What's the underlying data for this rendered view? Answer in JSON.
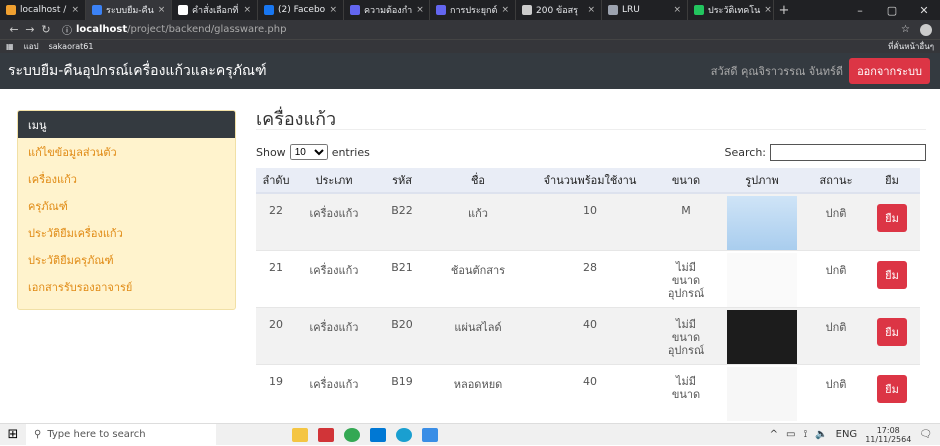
{
  "browser": {
    "tabs": [
      {
        "label": "localhost /",
        "color": "#f0a030"
      },
      {
        "label": "ระบบยืม-คืน",
        "color": "#3b82f6",
        "active": true
      },
      {
        "label": "คำสั่งเลือกที่",
        "color": "#ffffff"
      },
      {
        "label": "(2) Facebo",
        "color": "#1877f2"
      },
      {
        "label": "ความต้องกำ",
        "color": "#6366f1"
      },
      {
        "label": "การประยุกต์",
        "color": "#6366f1"
      },
      {
        "label": "200 ข้อสรุ",
        "color": "#cccccc"
      },
      {
        "label": "LRU",
        "color": "#9ca3af"
      },
      {
        "label": "ประวัติเทคโน",
        "color": "#22c55e"
      }
    ],
    "url_host": "localhost",
    "url_path": "/project/backend/glassware.php",
    "bookmarks": {
      "apps": "แอป",
      "profile": "sakaorat61",
      "other": "ที่คั่นหน้าอื่นๆ"
    }
  },
  "navbar": {
    "brand": "ระบบยืม-คืนอุปกรณ์เครื่องแก้วและครุภัณฑ์",
    "user": "สวัสดี คุณจิราวรรณ จันทร์ดี",
    "logout": "ออกจากระบบ"
  },
  "sidebar": {
    "header": "เมนู",
    "items": [
      {
        "label": "แก้ไขข้อมูลส่วนตัว"
      },
      {
        "label": "เครื่องแก้ว"
      },
      {
        "label": "ครุภัณฑ์"
      },
      {
        "label": "ประวัติยืมเครื่องแก้ว"
      },
      {
        "label": "ประวัติยืมครุภัณฑ์"
      },
      {
        "label": "เอกสารรับรองอาจารย์"
      }
    ]
  },
  "main": {
    "title": "เครื่องแก้ว",
    "show_label": "Show",
    "entries_value": "10",
    "entries_label": "entries",
    "search_label": "Search:",
    "search_value": "",
    "columns": [
      "ลำดับ",
      "ประเภท",
      "รหัส",
      "ชื่อ",
      "จำนวนพร้อมใช้งาน",
      "ขนาด",
      "รูปภาพ",
      "สถานะ",
      "ยืม"
    ],
    "rows": [
      {
        "no": "22",
        "type": "เครื่องแก้ว",
        "code": "B22",
        "name": "แก้ว",
        "qty": "10",
        "size": "M",
        "image": "flask-image",
        "status": "ปกติ",
        "action": "ยืม"
      },
      {
        "no": "21",
        "type": "เครื่องแก้ว",
        "code": "B21",
        "name": "ช้อนตักสาร",
        "qty": "28",
        "size": "ไม่มีขนาดอุปกรณ์",
        "image": "spatula-image",
        "status": "ปกติ",
        "action": "ยืม"
      },
      {
        "no": "20",
        "type": "เครื่องแก้ว",
        "code": "B20",
        "name": "แผ่นสไลด์",
        "qty": "40",
        "size": "ไม่มีขนาดอุปกรณ์",
        "image": "slide-image",
        "status": "ปกติ",
        "action": "ยืม"
      },
      {
        "no": "19",
        "type": "เครื่องแก้ว",
        "code": "B19",
        "name": "หลอดหยด",
        "qty": "40",
        "size": "ไม่มีขนาด",
        "image": "dropper-image",
        "status": "ปกติ",
        "action": "ยืม"
      }
    ]
  },
  "taskbar": {
    "search_placeholder": "Type here to search",
    "lang": "ENG",
    "time": "17:08",
    "date": "11/11/2564"
  }
}
